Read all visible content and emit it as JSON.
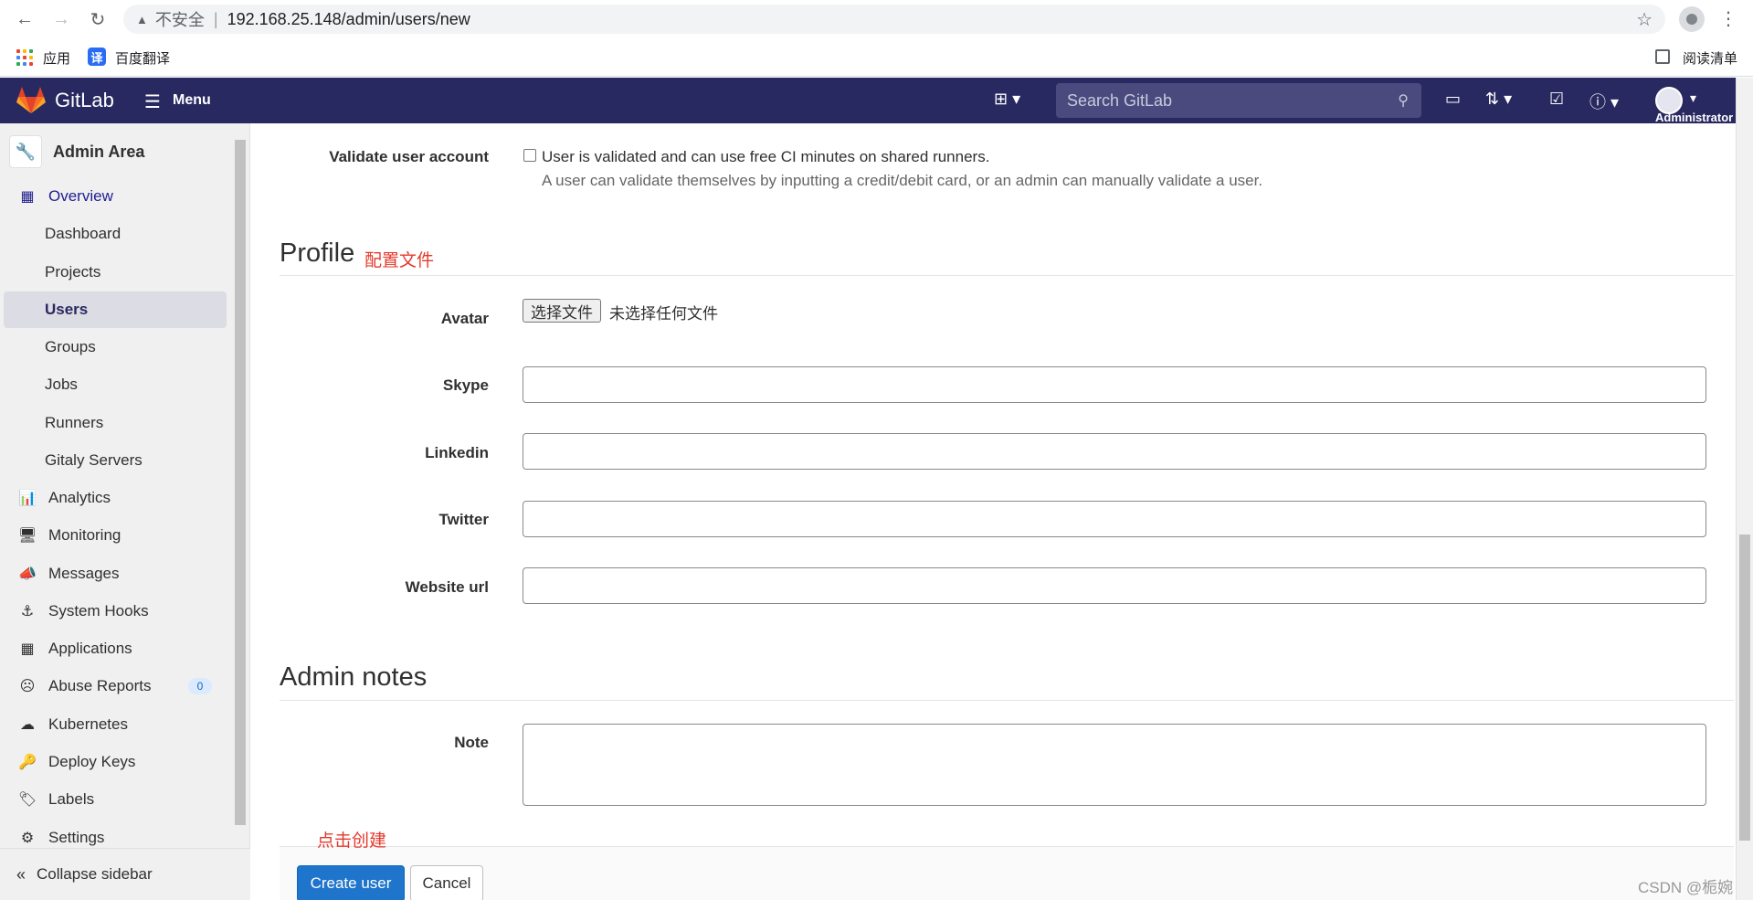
{
  "browser": {
    "insecure_label": "不安全",
    "url": "192.168.25.148/admin/users/new",
    "bookmarks": {
      "apps": "应用",
      "translate_icon": "译",
      "translate": "百度翻译",
      "reading_list": "阅读清单"
    }
  },
  "gitlab_nav": {
    "brand": "GitLab",
    "menu": "Menu",
    "search_placeholder": "Search GitLab",
    "user_name": "Administrator"
  },
  "sidebar": {
    "title": "Admin Area",
    "overview": "Overview",
    "overview_items": [
      "Dashboard",
      "Projects",
      "Users",
      "Groups",
      "Jobs",
      "Runners",
      "Gitaly Servers"
    ],
    "active_item": "Users",
    "sections": [
      "Analytics",
      "Monitoring",
      "Messages",
      "System Hooks",
      "Applications",
      "Abuse Reports",
      "Kubernetes",
      "Deploy Keys",
      "Labels",
      "Settings"
    ],
    "abuse_reports_count": "0",
    "collapse": "Collapse sidebar"
  },
  "form": {
    "validate_label": "Validate user account",
    "validate_checkbox_text": "User is validated and can use free CI minutes on shared runners.",
    "validate_help": "A user can validate themselves by inputting a credit/debit card, or an admin can manually validate a user.",
    "profile_title": "Profile",
    "profile_note": "配置文件",
    "avatar_label": "Avatar",
    "file_button": "选择文件",
    "file_status": "未选择任何文件",
    "skype_label": "Skype",
    "linkedin_label": "Linkedin",
    "twitter_label": "Twitter",
    "website_label": "Website url",
    "admin_notes_title": "Admin notes",
    "note_label": "Note",
    "create_note": "点击创建",
    "create_button": "Create user",
    "cancel_button": "Cancel"
  },
  "watermark": "CSDN @栀婉"
}
